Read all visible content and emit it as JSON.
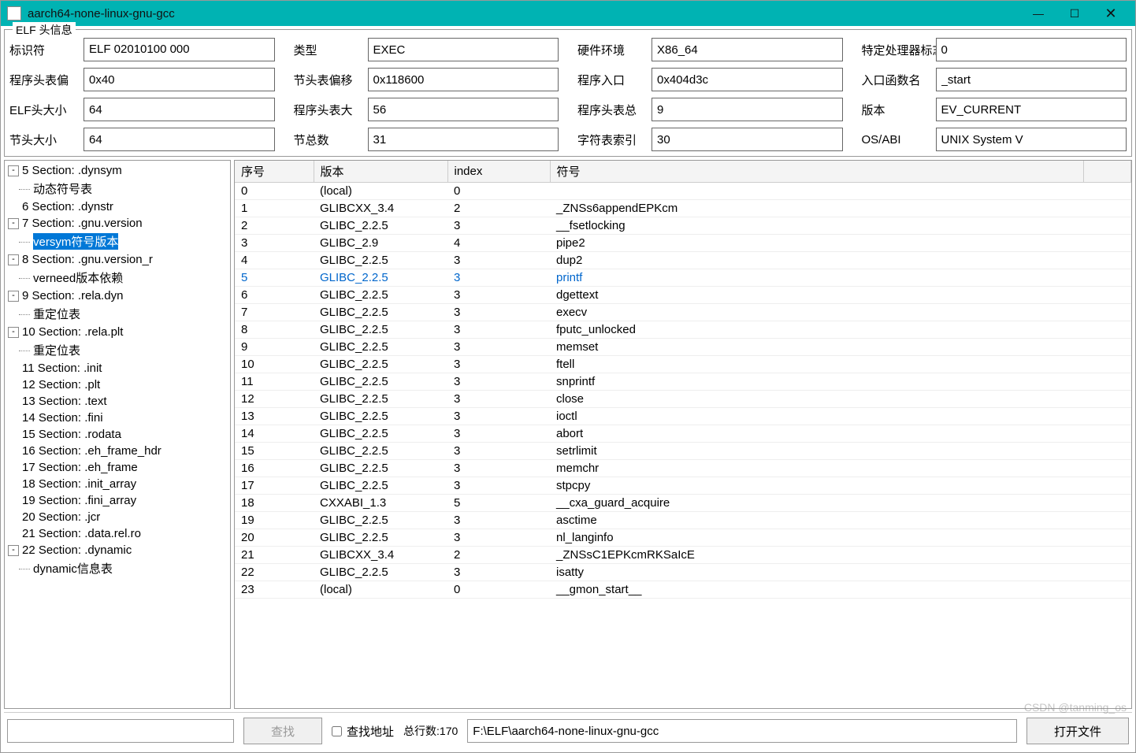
{
  "window": {
    "title": "aarch64-none-linux-gnu-gcc"
  },
  "groupbox": {
    "legend": "ELF 头信息"
  },
  "fields": {
    "row1": [
      {
        "label": "标识符",
        "value": "ELF 02010100 000"
      },
      {
        "label": "类型",
        "value": "EXEC"
      },
      {
        "label": "硬件环境",
        "value": "X86_64"
      },
      {
        "label": "特定处理器标志",
        "value": "0"
      }
    ],
    "row2": [
      {
        "label": "程序头表偏",
        "value": "0x40"
      },
      {
        "label": "节头表偏移",
        "value": "0x118600"
      },
      {
        "label": "程序入口",
        "value": "0x404d3c"
      },
      {
        "label": "入口函数名",
        "value": "_start"
      }
    ],
    "row3": [
      {
        "label": "ELF头大小",
        "value": "64"
      },
      {
        "label": "程序头表大",
        "value": "56"
      },
      {
        "label": "程序头表总",
        "value": "9"
      },
      {
        "label": "版本",
        "value": "EV_CURRENT"
      }
    ],
    "row4": [
      {
        "label": "节头大小",
        "value": "64"
      },
      {
        "label": "节总数",
        "value": "31"
      },
      {
        "label": "字符表索引",
        "value": "30"
      },
      {
        "label": "OS/ABI",
        "value": "UNIX System V"
      }
    ]
  },
  "tree": [
    {
      "exp": "-",
      "text": "5 Section: .dynsym",
      "children": [
        "动态符号表"
      ]
    },
    {
      "exp": "",
      "text": "6 Section: .dynstr"
    },
    {
      "exp": "-",
      "text": "7 Section: .gnu.version",
      "children": [
        "versym符号版本"
      ],
      "selectedChild": 0
    },
    {
      "exp": "-",
      "text": "8 Section: .gnu.version_r",
      "children": [
        "verneed版本依赖"
      ]
    },
    {
      "exp": "-",
      "text": "9 Section: .rela.dyn",
      "children": [
        "重定位表"
      ]
    },
    {
      "exp": "-",
      "text": "10 Section: .rela.plt",
      "children": [
        "重定位表"
      ]
    },
    {
      "exp": "",
      "text": "11 Section: .init"
    },
    {
      "exp": "",
      "text": "12 Section: .plt"
    },
    {
      "exp": "",
      "text": "13 Section: .text"
    },
    {
      "exp": "",
      "text": "14 Section: .fini"
    },
    {
      "exp": "",
      "text": "15 Section: .rodata"
    },
    {
      "exp": "",
      "text": "16 Section: .eh_frame_hdr"
    },
    {
      "exp": "",
      "text": "17 Section: .eh_frame"
    },
    {
      "exp": "",
      "text": "18 Section: .init_array"
    },
    {
      "exp": "",
      "text": "19 Section: .fini_array"
    },
    {
      "exp": "",
      "text": "20 Section: .jcr"
    },
    {
      "exp": "",
      "text": "21 Section: .data.rel.ro"
    },
    {
      "exp": "-",
      "text": "22 Section: .dynamic",
      "children": [
        "dynamic信息表"
      ]
    }
  ],
  "table": {
    "headers": [
      "序号",
      "版本",
      "index",
      "符号"
    ],
    "highlightRow": 5,
    "rows": [
      [
        "0",
        "(local)",
        "0",
        ""
      ],
      [
        "1",
        "GLIBCXX_3.4",
        "2",
        "_ZNSs6appendEPKcm"
      ],
      [
        "2",
        "GLIBC_2.2.5",
        "3",
        "__fsetlocking"
      ],
      [
        "3",
        "GLIBC_2.9",
        "4",
        "pipe2"
      ],
      [
        "4",
        "GLIBC_2.2.5",
        "3",
        "dup2"
      ],
      [
        "5",
        "GLIBC_2.2.5",
        "3",
        "printf"
      ],
      [
        "6",
        "GLIBC_2.2.5",
        "3",
        "dgettext"
      ],
      [
        "7",
        "GLIBC_2.2.5",
        "3",
        "execv"
      ],
      [
        "8",
        "GLIBC_2.2.5",
        "3",
        "fputc_unlocked"
      ],
      [
        "9",
        "GLIBC_2.2.5",
        "3",
        "memset"
      ],
      [
        "10",
        "GLIBC_2.2.5",
        "3",
        "ftell"
      ],
      [
        "11",
        "GLIBC_2.2.5",
        "3",
        "snprintf"
      ],
      [
        "12",
        "GLIBC_2.2.5",
        "3",
        "close"
      ],
      [
        "13",
        "GLIBC_2.2.5",
        "3",
        "ioctl"
      ],
      [
        "14",
        "GLIBC_2.2.5",
        "3",
        "abort"
      ],
      [
        "15",
        "GLIBC_2.2.5",
        "3",
        "setrlimit"
      ],
      [
        "16",
        "GLIBC_2.2.5",
        "3",
        "memchr"
      ],
      [
        "17",
        "GLIBC_2.2.5",
        "3",
        "stpcpy"
      ],
      [
        "18",
        "CXXABI_1.3",
        "5",
        "__cxa_guard_acquire"
      ],
      [
        "19",
        "GLIBC_2.2.5",
        "3",
        "asctime"
      ],
      [
        "20",
        "GLIBC_2.2.5",
        "3",
        "nl_langinfo"
      ],
      [
        "21",
        "GLIBCXX_3.4",
        "2",
        "_ZNSsC1EPKcmRKSaIcE"
      ],
      [
        "22",
        "GLIBC_2.2.5",
        "3",
        "isatty"
      ],
      [
        "23",
        "(local)",
        "0",
        "__gmon_start__"
      ]
    ]
  },
  "bottom": {
    "search_btn": "查找",
    "search_addr_cb": "查找地址",
    "total_rows": "总行数:170",
    "path": "F:\\ELF\\aarch64-none-linux-gnu-gcc",
    "open_btn": "打开文件"
  },
  "watermark": "CSDN @tanming_os"
}
